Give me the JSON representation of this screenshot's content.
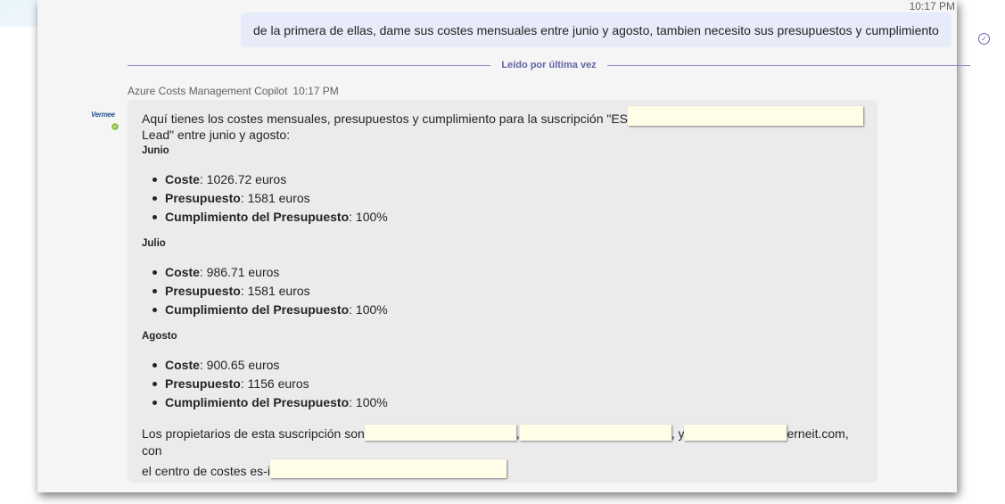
{
  "header": {
    "timestamp": "10:17 PM"
  },
  "user_message": {
    "text": "de la primera de ellas, dame sus costes mensuales entre junio y agosto, tambien necesito sus presupuestos y cumplimiento"
  },
  "read_marker": {
    "label": "Leído por última vez"
  },
  "bot_message": {
    "sender": "Azure Costs Management Copilot",
    "time": "10:17 PM",
    "avatar_text": "Vermee",
    "intro_start": "Aquí tienes los costes mensuales, presupuestos y cumplimiento para la suscripción \"ES",
    "intro_end": "Lead\" entre junio y agosto:",
    "sections": [
      {
        "title": "Junio",
        "items": [
          {
            "label": "Coste",
            "value": ": 1026.72 euros"
          },
          {
            "label": "Presupuesto",
            "value": ": 1581 euros"
          },
          {
            "label": "Cumplimiento del Presupuesto",
            "value": ": 100%"
          }
        ]
      },
      {
        "title": "Julio",
        "items": [
          {
            "label": "Coste",
            "value": ": 986.71 euros"
          },
          {
            "label": "Presupuesto",
            "value": ": 1581 euros"
          },
          {
            "label": "Cumplimiento del Presupuesto",
            "value": ": 100%"
          }
        ]
      },
      {
        "title": "Agosto",
        "items": [
          {
            "label": "Coste",
            "value": ": 900.65 euros"
          },
          {
            "label": "Presupuesto",
            "value": ": 1156 euros"
          },
          {
            "label": "Cumplimiento del Presupuesto",
            "value": ": 100%"
          }
        ]
      }
    ],
    "owners_start": "Los propietarios de esta suscripción son",
    "owners_sep1": ",",
    "owners_sep2": ", y",
    "owners_domain": "erneit.com, con",
    "owners_end": "el centro de costes es-i"
  },
  "colors": {
    "accent": "#6264a7",
    "user_bubble": "#e8ebfa",
    "bot_bubble": "#ebebeb",
    "status_available": "#92c353"
  }
}
